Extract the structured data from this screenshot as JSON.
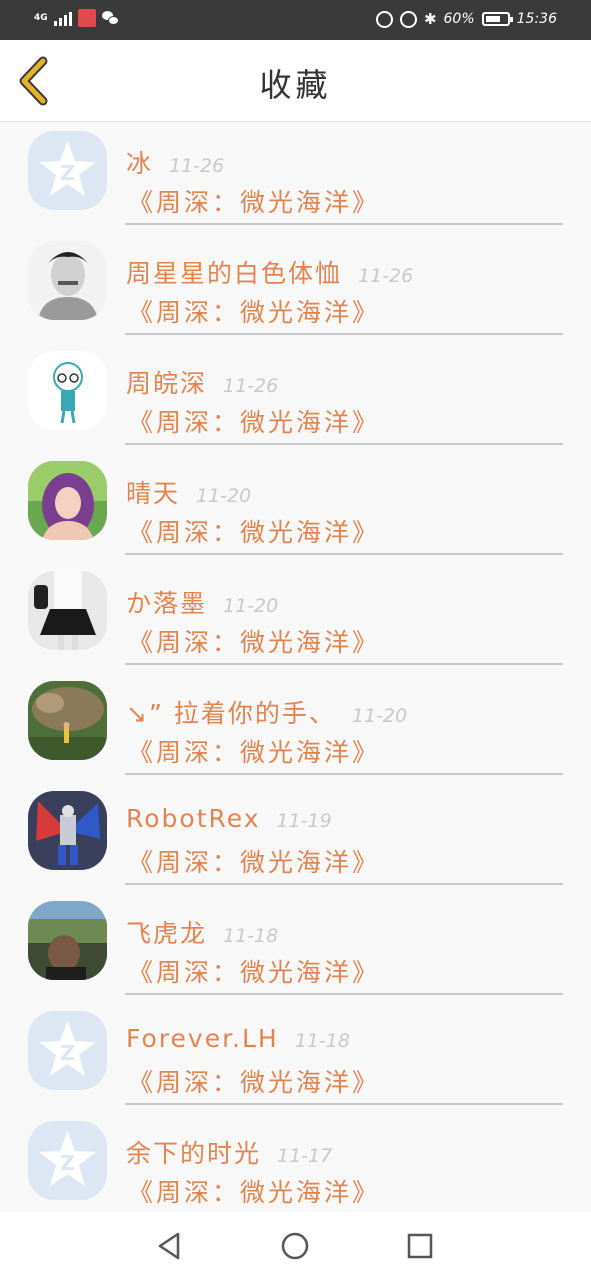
{
  "status_bar": {
    "network": "4G",
    "battery_percent": "60%",
    "time": "15:36",
    "app_badge": "",
    "icons": [
      "signal-icon",
      "app-icon",
      "wechat-icon",
      "nfc-icon",
      "alarm-icon",
      "bluetooth-icon",
      "battery-icon"
    ]
  },
  "header": {
    "title": "收藏",
    "back_icon": "chevron-left-icon",
    "accent": "#e3b22a"
  },
  "favorites": [
    {
      "name": "冰",
      "date": "11-26",
      "book": "《周深：微光海洋》",
      "avatar": "qq-default"
    },
    {
      "name": "周星星的白色体恤",
      "date": "11-26",
      "book": "《周深：微光海洋》",
      "avatar": "photo-boy"
    },
    {
      "name": "周皖深",
      "date": "11-26",
      "book": "《周深：微光海洋》",
      "avatar": "cartoon"
    },
    {
      "name": "晴天",
      "date": "11-20",
      "book": "《周深：微光海洋》",
      "avatar": "photo-girl"
    },
    {
      "name": "か落墨",
      "date": "11-20",
      "book": "《周深：微光海洋》",
      "avatar": "photo-outfit"
    },
    {
      "name": "↘” 拉着你的手、",
      "date": "11-20",
      "book": "《周深：微光海洋》",
      "avatar": "photo-tree"
    },
    {
      "name": "RobotRex",
      "date": "11-19",
      "book": "《周深：微光海洋》",
      "avatar": "photo-robot"
    },
    {
      "name": "飞虎龙",
      "date": "11-18",
      "book": "《周深：微光海洋》",
      "avatar": "photo-man"
    },
    {
      "name": "Forever.LH",
      "date": "11-18",
      "book": "《周深：微光海洋》",
      "avatar": "qq-default"
    },
    {
      "name": "余下的时光",
      "date": "11-17",
      "book": "《周深：微光海洋》",
      "avatar": "qq-default"
    }
  ],
  "nav_bar": {
    "back": "triangle-back-icon",
    "home": "circle-home-icon",
    "recents": "square-recents-icon"
  },
  "colors": {
    "text_accent": "#e2844f",
    "date": "#c9c9c9",
    "avatar_default": "#dde7f3"
  }
}
